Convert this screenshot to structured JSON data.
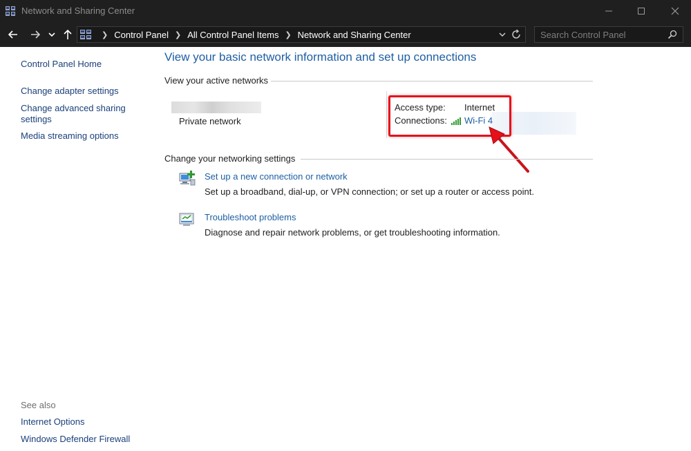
{
  "window": {
    "title": "Network and Sharing Center",
    "icon": "network-control-panel-icon"
  },
  "address_bar": {
    "breadcrumbs": [
      "Control Panel",
      "All Control Panel Items",
      "Network and Sharing Center"
    ],
    "search_placeholder": "Search Control Panel"
  },
  "left_pane": {
    "links": [
      "Control Panel Home",
      "Change adapter settings",
      "Change advanced sharing settings",
      "Media streaming options"
    ],
    "see_also_label": "See also",
    "see_also_links": [
      "Internet Options",
      "Windows Defender Firewall"
    ]
  },
  "main": {
    "heading": "View your basic network information and set up connections",
    "active_networks_label": "View your active networks",
    "network": {
      "category": "Private network",
      "access_type_label": "Access type:",
      "access_type_value": "Internet",
      "connections_label": "Connections:",
      "connection_name": "Wi-Fi 4",
      "connection_icon": "wifi-signal-icon"
    },
    "change_settings_label": "Change your networking settings",
    "tasks": [
      {
        "icon": "new-connection-icon",
        "link": "Set up a new connection or network",
        "description": "Set up a broadband, dial-up, or VPN connection; or set up a router or access point."
      },
      {
        "icon": "troubleshoot-icon",
        "link": "Troubleshoot problems",
        "description": "Diagnose and repair network problems, or get troubleshooting information."
      }
    ]
  },
  "colors": {
    "accent": "#1e5fa3",
    "highlight_red": "#e5101b",
    "titlebar": "#1f1f1f"
  }
}
